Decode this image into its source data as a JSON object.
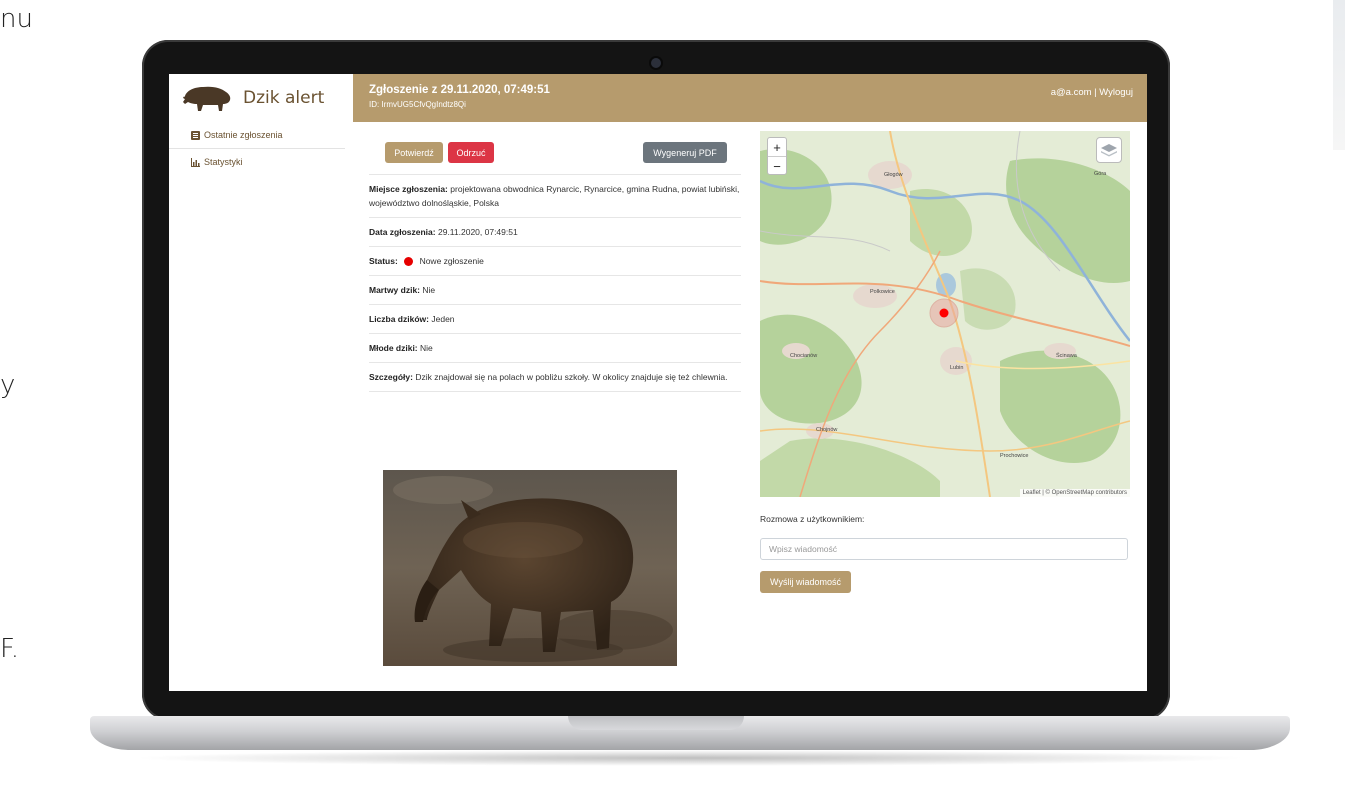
{
  "background_text": {
    "line1": "nu",
    "line2": "y",
    "line3": "F."
  },
  "app": {
    "brand": "Dzik alert",
    "sidebar": {
      "items": [
        {
          "label": "Ostatnie zgłoszenia",
          "icon": "list-icon"
        },
        {
          "label": "Statystyki",
          "icon": "chart-icon"
        }
      ]
    },
    "header": {
      "title": "Zgłoszenie z 29.11.2020, 07:49:51",
      "id": "ID: IrmvUG5CfvQgIndtz8Qi",
      "user": "a@a.com",
      "separator": "|",
      "logout": "Wyloguj"
    },
    "actions": {
      "confirm": "Potwierdź",
      "reject": "Odrzuć",
      "pdf": "Wygeneruj PDF"
    },
    "details": {
      "location_label": "Miejsce zgłoszenia:",
      "location_value": "projektowana obwodnica Rynarcic, Rynarcice, gmina Rudna, powiat lubiński, województwo dolnośląskie, Polska",
      "date_label": "Data zgłoszenia:",
      "date_value": "29.11.2020, 07:49:51",
      "status_label": "Status:",
      "status_value": "Nowe zgłoszenie",
      "dead_label": "Martwy dzik:",
      "dead_value": "Nie",
      "count_label": "Liczba dzików:",
      "count_value": "Jeden",
      "young_label": "Młode dziki:",
      "young_value": "Nie",
      "details_label": "Szczegóły:",
      "details_value": "Dzik znajdował się na polach w pobliżu szkoły. W okolicy znajduje się też chlewnia."
    },
    "map": {
      "zoom_in": "+",
      "zoom_out": "−",
      "attribution": "Leaflet | © OpenStreetMap contributors",
      "places": [
        "Głogów",
        "Polkowice",
        "Chocianów",
        "Lubin",
        "Ścinawa",
        "Chojnów",
        "Prochowice",
        "Góra"
      ]
    },
    "chat": {
      "label": "Rozmowa z użytkownikiem:",
      "placeholder": "Wpisz wiadomość",
      "send": "Wyślij wiadomość"
    },
    "colors": {
      "brand": "#b69b6d",
      "danger": "#dc3545",
      "secondary": "#6c757d",
      "status_new": "#e60000"
    }
  }
}
